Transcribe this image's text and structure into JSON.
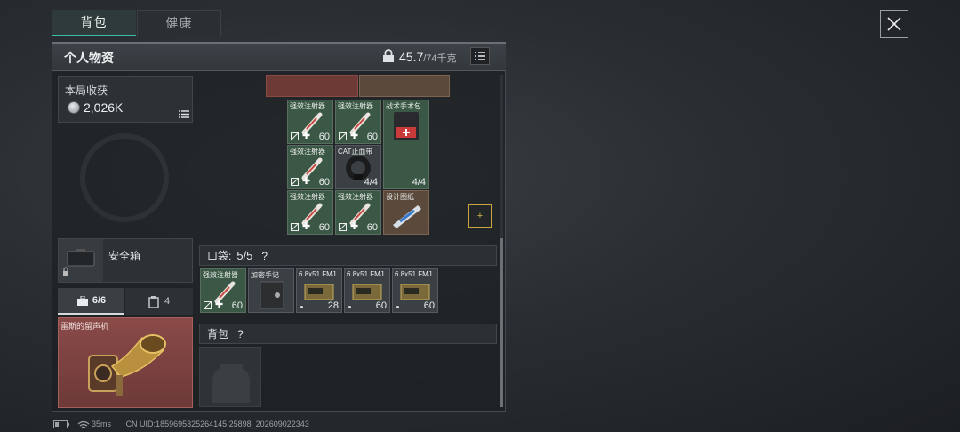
{
  "tabs": {
    "backpack": "背包",
    "health": "健康"
  },
  "panel": {
    "title": "个人物资",
    "weight_current": "45.7",
    "weight_max": "/74千克"
  },
  "harvest": {
    "label": "本局收获",
    "value": "2,026K"
  },
  "safe_box": {
    "label": "安全箱"
  },
  "subtabs": {
    "tools": "6/6",
    "cards": "4"
  },
  "special_item": {
    "name": "雷斯的留声机"
  },
  "backpack_items": [
    {
      "name": "强效注射器",
      "value": "60"
    },
    {
      "name": "强效注射器",
      "value": "60"
    },
    {
      "name": "战术手术包",
      "value": "4/4"
    },
    {
      "name": "强效注射器",
      "value": "60"
    },
    {
      "name": "CAT止血带",
      "value": "4/4"
    },
    {
      "name": "强效注射器",
      "value": "60"
    },
    {
      "name": "强效注射器",
      "value": "60"
    },
    {
      "name": "设计图纸",
      "value": ""
    }
  ],
  "pocket": {
    "label": "口袋:",
    "count": "5/5",
    "help": "?",
    "items": [
      {
        "name": "强效注射器",
        "value": "60"
      },
      {
        "name": "加密手记",
        "value": ""
      },
      {
        "name": "6.8x51 FMJ",
        "value": "28"
      },
      {
        "name": "6.8x51 FMJ",
        "value": "60"
      },
      {
        "name": "6.8x51 FMJ",
        "value": "60"
      }
    ]
  },
  "backpack_section": {
    "label": "背包",
    "help": "?"
  },
  "status_bar": {
    "ping": "35ms",
    "uid": "CN UID:1859695325264145 25898_202609022343"
  },
  "colors": {
    "accent": "#35c0a6",
    "item_green": "#3b5846",
    "item_red": "#7a3a36",
    "gold": "#c9a640"
  }
}
